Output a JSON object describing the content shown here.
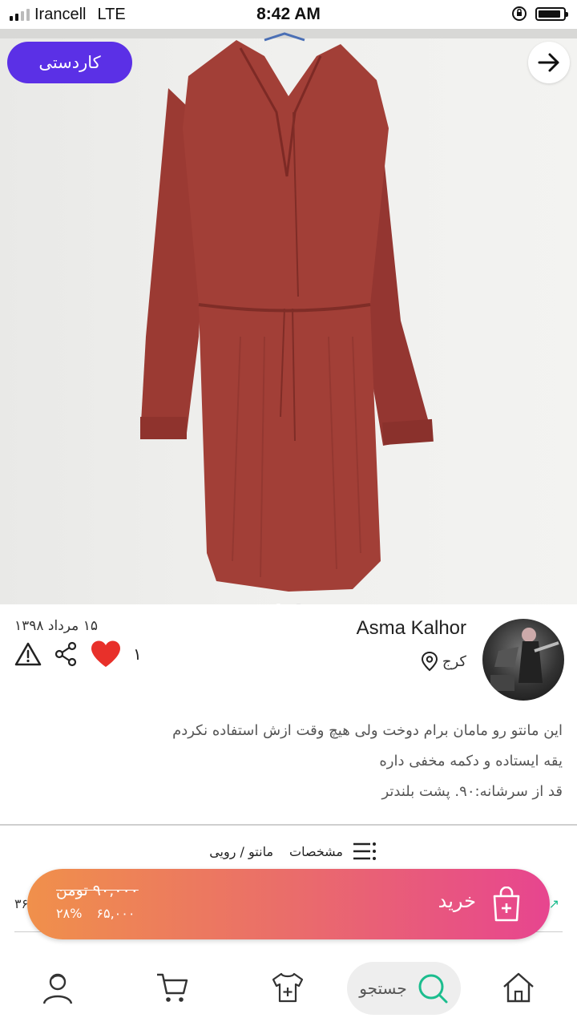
{
  "status_bar": {
    "carrier": "Irancell",
    "network": "LTE",
    "time": "8:42 AM"
  },
  "photo": {
    "used_tag": "کاردستی",
    "dots_total": 2,
    "dots_active": 1
  },
  "seller": {
    "name": "Asma Kalhor",
    "city": "کرج",
    "date": "۱۵ مرداد ۱۳۹۸"
  },
  "actions": {
    "like_count": "۱"
  },
  "description": {
    "lines": [
      "این مانتو رو مامان برام دوخت ولی هیچ وقت ازش استفاده نکردم",
      "یقه ایستاده و دکمه مخفی داره",
      "قد از سرشانه:۹۰. پشت بلندتر"
    ]
  },
  "specs": {
    "label": "مشخصات",
    "category": "مانتو / رویی"
  },
  "buy_bar": {
    "old_price": "۹۰,۰۰۰ تومن",
    "new_price": "۶۵,۰۰۰",
    "discount": "۲۸%",
    "label": "خرید"
  },
  "side": {
    "partial_number": "۳۶"
  },
  "bottom_nav": {
    "search_label": "جستجو"
  },
  "colors": {
    "accent_purple": "#5b30e6",
    "buy_gradient_start": "#f0904b",
    "buy_gradient_end": "#e7458f",
    "like_red": "#e8302a",
    "search_green": "#1bbd8e"
  }
}
